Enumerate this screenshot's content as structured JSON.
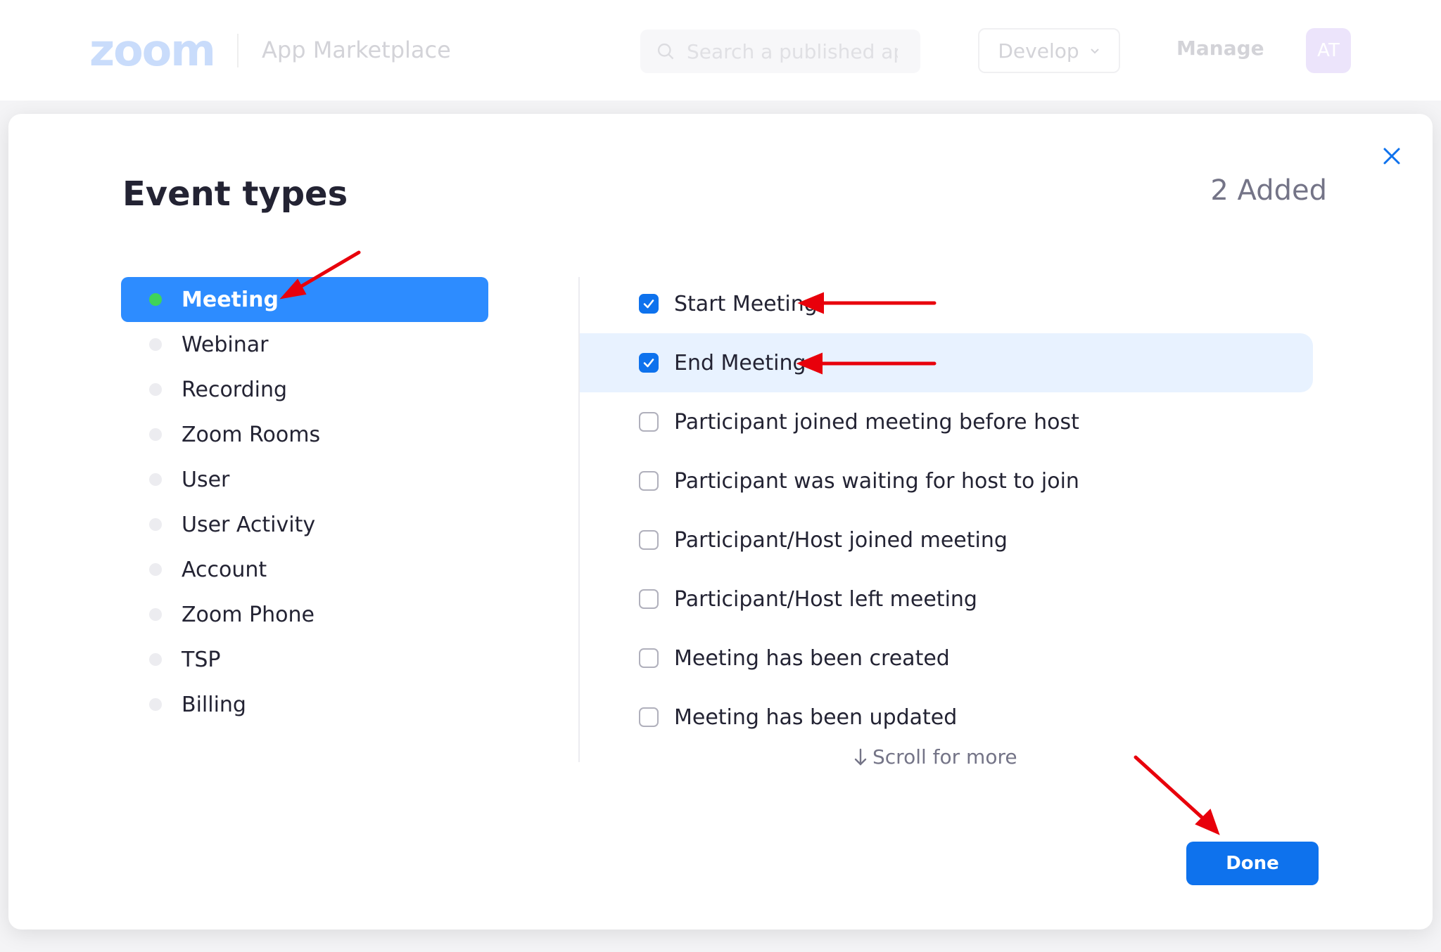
{
  "topbar": {
    "logo_text": "zoom",
    "marketplace_label": "App Marketplace",
    "search_placeholder": "Search a published app",
    "develop_label": "Develop",
    "manage_label": "Manage",
    "avatar_initials": "AT"
  },
  "modal": {
    "title": "Event types",
    "added_count": "2 Added",
    "categories": [
      {
        "label": "Meeting",
        "active": true
      },
      {
        "label": "Webinar",
        "active": false
      },
      {
        "label": "Recording",
        "active": false
      },
      {
        "label": "Zoom Rooms",
        "active": false
      },
      {
        "label": "User",
        "active": false
      },
      {
        "label": "User Activity",
        "active": false
      },
      {
        "label": "Account",
        "active": false
      },
      {
        "label": "Zoom Phone",
        "active": false
      },
      {
        "label": "TSP",
        "active": false
      },
      {
        "label": "Billing",
        "active": false
      }
    ],
    "events": [
      {
        "label": "Start Meeting",
        "checked": true,
        "highlight": false
      },
      {
        "label": "End Meeting",
        "checked": true,
        "highlight": true
      },
      {
        "label": "Participant joined meeting before host",
        "checked": false,
        "highlight": false
      },
      {
        "label": "Participant was waiting for host to join",
        "checked": false,
        "highlight": false
      },
      {
        "label": "Participant/Host joined meeting",
        "checked": false,
        "highlight": false
      },
      {
        "label": "Participant/Host left meeting",
        "checked": false,
        "highlight": false
      },
      {
        "label": "Meeting has been created",
        "checked": false,
        "highlight": false
      },
      {
        "label": "Meeting has been updated",
        "checked": false,
        "highlight": false
      }
    ],
    "scroll_hint": "Scroll for more",
    "done_label": "Done"
  },
  "colors": {
    "primary": "#0e72ed",
    "active_category": "#2d8cff",
    "active_dot": "#3fd35a",
    "highlight_row": "#e8f2ff",
    "annotation_arrow": "#e8000b"
  }
}
